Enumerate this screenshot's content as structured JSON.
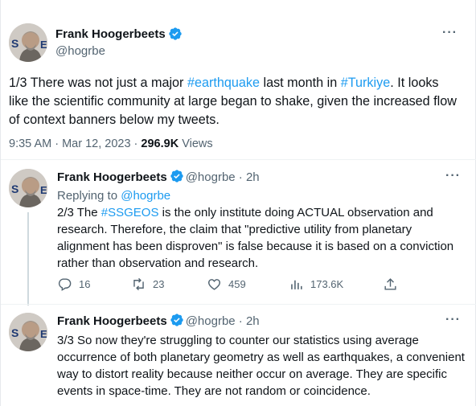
{
  "main_tweet": {
    "author_name": "Frank Hoogerbeets",
    "handle": "@hogrbe",
    "text_parts": [
      "1/3 There was not just a major ",
      "#earthquake",
      " last month in ",
      "#Turkiye",
      ". It looks like the scientific community at large began to shake, given the increased flow of context banners below my tweets."
    ],
    "timestamp": "9:35 AM · Mar 12, 2023 · ",
    "views_count": "296.9K",
    "views_label": " Views",
    "more_label": "···"
  },
  "replies": [
    {
      "author_name": "Frank Hoogerbeets",
      "handle_time": "@hogrbe · 2h",
      "replying_prefix": "Replying to ",
      "replying_handle": "@hogrbe",
      "text_parts": [
        "2/3 The ",
        "#SSGEOS",
        " is the only institute doing ACTUAL observation and research. Therefore, the claim that \"predictive utility from planetary alignment has been disproven\" is false because it is based on a conviction rather than observation and research."
      ],
      "actions": {
        "replies": "16",
        "retweets": "23",
        "likes": "459",
        "views": "173.6K"
      },
      "more_label": "···"
    },
    {
      "author_name": "Frank Hoogerbeets",
      "handle_time": "@hogrbe · 2h",
      "text": "3/3 So now they're struggling to counter our statistics using average occurrence of both planetary geometry as well as earthquakes, a convenient way to distort reality because neither occur on average. They are specific events in space-time. They are not random or coincidence.",
      "more_label": "···"
    }
  ],
  "icons": {
    "verified": "verified-badge-icon",
    "reply": "reply-icon",
    "retweet": "retweet-icon",
    "like": "heart-icon",
    "views": "analytics-icon",
    "share": "share-icon",
    "more": "more-icon"
  },
  "colors": {
    "accent": "#1d9bf0",
    "text": "#0f1419",
    "muted": "#536471",
    "divider": "#eff3f4"
  }
}
